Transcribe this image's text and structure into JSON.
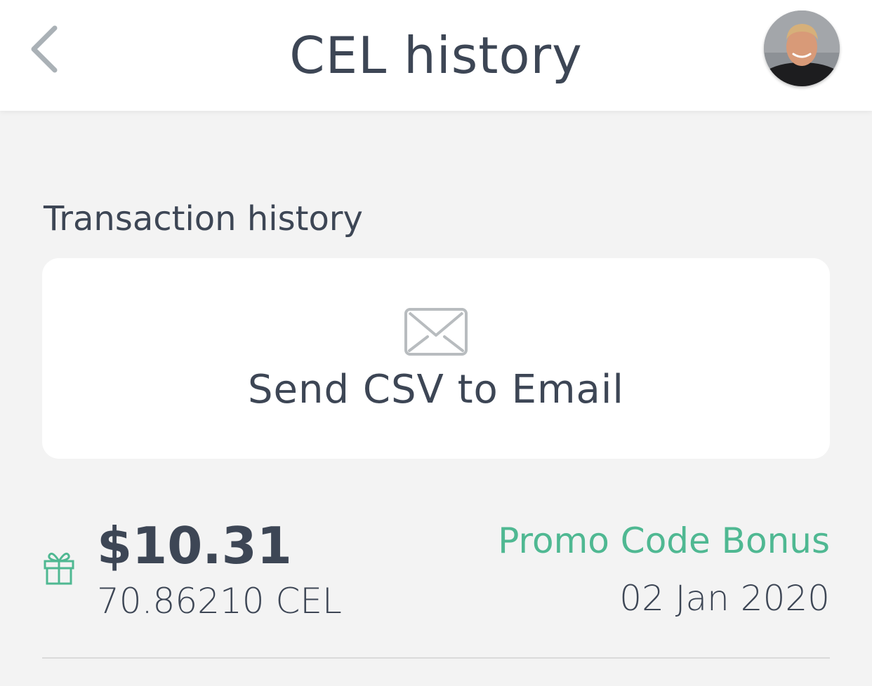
{
  "header": {
    "title": "CEL history",
    "back_icon": "chevron-left-icon",
    "avatar_icon": "user-avatar"
  },
  "section": {
    "label": "Transaction history"
  },
  "csv_card": {
    "icon": "mail-icon",
    "label": "Send CSV to Email"
  },
  "transactions": [
    {
      "icon": "gift-icon",
      "amount_usd": "$10.31",
      "amount_crypto": "70.86210 CEL",
      "type": "Promo Code Bonus",
      "date": "02 Jan 2020",
      "type_color": "#4fb892"
    }
  ],
  "colors": {
    "text_primary": "#3d4655",
    "accent_green": "#4fb892",
    "background": "#f3f3f3",
    "card": "#ffffff",
    "icon_gray": "#b8bcbf"
  }
}
